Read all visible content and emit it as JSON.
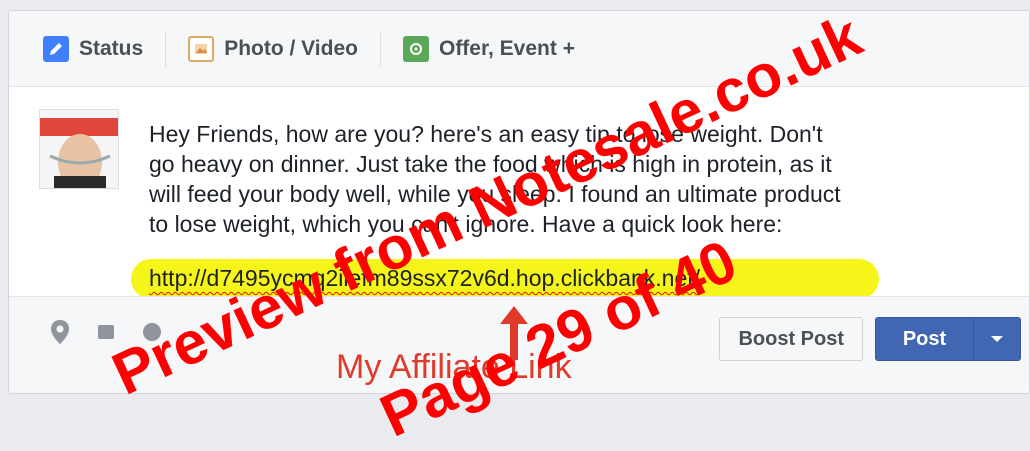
{
  "tabs": [
    {
      "label": "Status",
      "icon": "pencil-icon"
    },
    {
      "label": "Photo / Video",
      "icon": "photo-icon"
    },
    {
      "label": "Offer, Event +",
      "icon": "offer-icon"
    }
  ],
  "composer": {
    "message_lines": [
      "Hey Friends, how are you? here's an easy tip to lose weight. Don't",
      "go heavy on dinner. Just take the food which is high in protein, as it",
      "will feed your body well, while you sleep. I found an ultimate product",
      "to lose weight, which you can't ignore. Have a quick look here:"
    ],
    "link": "http://d7495ycmq2ilefm89ssx72v6d.hop.clickbank.net/"
  },
  "footer": {
    "boost_label": "Boost Post",
    "post_label": "Post"
  },
  "annotation": {
    "label": "My Affiliate Link"
  },
  "watermark": {
    "line1": "Preview from Notesale.co.uk",
    "line2": "Page 29 of 40"
  },
  "colors": {
    "facebook_blue": "#4267b2",
    "highlight": "#f4f400",
    "annotation_red": "#e03a2a",
    "watermark_red": "#ff0000"
  }
}
